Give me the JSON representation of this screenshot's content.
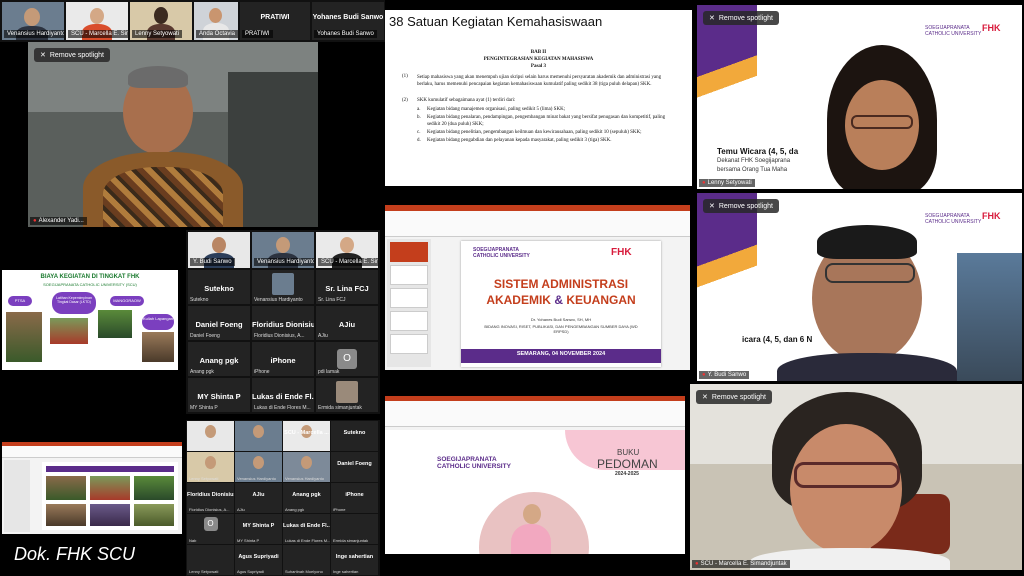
{
  "top_strip": {
    "cells": [
      {
        "name": "Venansius Hardiyanto"
      },
      {
        "name": "SCU - Marcella E. Sima..."
      },
      {
        "name": "Lenny Setyowati"
      },
      {
        "name": "Anda Octavia"
      },
      {
        "name": "PRATIWI",
        "label": "PRATIWI"
      },
      {
        "name": "Yohanes Budi Sanwo",
        "label": "Yohanes Budi Sanwo"
      }
    ]
  },
  "main_speaker": {
    "spotlight": "Remove spotlight",
    "name": "Alexander Yadi..."
  },
  "document": {
    "title": "38 Satuan Kegiatan Kemahasiswaan",
    "bab": "BAB II",
    "heading": "PENGINTEGRASIAN KEGIATAN MAHASISWA",
    "pasal": "Pasal 3",
    "para1_num": "(1)",
    "para1": "Setiap mahasiswa yang akan menempuh ujian skripsi selain harus memenuhi persyaratan akademik dan administrasi yang berlaku, harus memenuhi pencapaian kegiatan kemahasiswaan kumulatif paling sedikit 38 (tiga puluh delapan) SKK.",
    "para2_num": "(2)",
    "para2": "SKK kumulatif sebagaimana ayat (1) terdiri dari:",
    "items": [
      {
        "letter": "a.",
        "text": "Kegiatan bidang manajemen organisasi, paling sedikit 5 (lima) SKK;"
      },
      {
        "letter": "b.",
        "text": "Kegiatan bidang penalaran, pendampingan, pengembangan minat bakat yang bersifat penugasan dan kompetitif, paling sedikit 20 (dua puluh) SKK;"
      },
      {
        "letter": "c.",
        "text": "Kegiatan bidang penelitian, pengembangan keilmuan dan kewirausahaan, paling sedikit 10 (sepuluh) SKK;"
      },
      {
        "letter": "d.",
        "text": "Kegiatan bidang pengabdian dan pelayanan kepada masyarakat, paling sedikit 3 (tiga) SKK."
      }
    ]
  },
  "right_top": {
    "spotlight": "Remove spotlight",
    "name": "Lenny Setyowati",
    "brand": "SOEGIJAPRANATA CATHOLIC UNIVERSITY",
    "fhk": "FHK",
    "banner_title": "Temu Wicara (4, 5, da",
    "banner_sub1": "Dekanat FHK Soegijaprana",
    "banner_sub2": "bersama Orang Tua Maha"
  },
  "right_mid": {
    "spotlight": "Remove spotlight",
    "name": "Y. Budi Sanwo",
    "brand": "SOEGIJAPRANATA CATHOLIC UNIVERSITY",
    "fhk": "FHK",
    "banner_title": "icara (4, 5, dan 6 N"
  },
  "right_bottom": {
    "spotlight": "Remove spotlight",
    "name": "SCU - Marcella E. Simandjuntak"
  },
  "biaya_slide": {
    "title": "BIAYA KEGIATAN DI TINGKAT FHK",
    "subtitle": "SOEGIJAPRANATA CATHOLIC UNIVERSITY (SCU)",
    "labels": [
      "PTSA",
      "Latihan Kepemimpinan Tingkat Dasar (LKTD)",
      "MANGGRAOW",
      "Kuliah Lapangan"
    ]
  },
  "gallery_mid": {
    "top_names": [
      "Y. Budi Sanwo",
      "Venansius Hardiyanto",
      "SCU - Marcella E. Sima..."
    ],
    "cells": [
      {
        "name": "Sutekno",
        "sub": "Sutekno"
      },
      {
        "name": "",
        "sub": "Venansius Hardiyanto"
      },
      {
        "name": "Sr. Lina FCJ",
        "sub": "Sr. Lina FCJ"
      },
      {
        "name": "Daniel Foeng",
        "sub": "Daniel Foeng"
      },
      {
        "name": "Floridius Dionisius...",
        "sub": "Floridius Dionisius, A..."
      },
      {
        "name": "AJiu",
        "sub": "AJiu"
      },
      {
        "name": "Anang pgk",
        "sub": "Anang pgk"
      },
      {
        "name": "iPhone",
        "sub": "iPhone"
      },
      {
        "name": "O",
        "sub": "pdi lamak"
      },
      {
        "name": "MY Shinta P",
        "sub": "MY Shinta P"
      },
      {
        "name": "Lukas di Ende Fl...",
        "sub": "Lukas di Ende Flores M..."
      },
      {
        "name": "",
        "sub": "Ermida simanjuntak"
      }
    ]
  },
  "ppt_slide": {
    "brand": "SOEGIJAPRANATA CATHOLIC UNIVERSITY",
    "fhk": "FHK",
    "title1": "SISTEM ADMINISTRASI",
    "title2": "AKADEMIK",
    "amp": "&",
    "title3": "KEUANGAN",
    "presenter": "Dr. Yohanes Budi Sanwo, SH, MH",
    "role": "BIDANG INOVASI, RISET, PUBLIKASI, DAN PENGEMBANGAN SUMBER DAYA (WD ERPSD)",
    "date": "SEMARANG, 04 NOVEMBER 2024"
  },
  "gallery_bottom": {
    "cells": [
      {
        "name": "",
        "sub": ""
      },
      {
        "name": "",
        "sub": ""
      },
      {
        "name": "SCU - Marcella ...",
        "sub": ""
      },
      {
        "name": "Sutekno",
        "sub": ""
      },
      {
        "name": "",
        "sub": "Lenny Setyowati"
      },
      {
        "name": "",
        "sub": "Venansius Hardiyanto"
      },
      {
        "name": "",
        "sub": "Venansius Hardiyanto"
      },
      {
        "name": "Daniel Foeng",
        "sub": ""
      },
      {
        "name": "Floridius Dionisius...",
        "sub": "Floridius Dionisius, A..."
      },
      {
        "name": "AJiu",
        "sub": "AJiu"
      },
      {
        "name": "Anang pgk",
        "sub": "Anang pgk"
      },
      {
        "name": "iPhone",
        "sub": "iPhone"
      },
      {
        "name": "O",
        "sub": "Nab"
      },
      {
        "name": "MY Shinta P",
        "sub": "MY Shinta P"
      },
      {
        "name": "Lukas di Ende Fl...",
        "sub": "Lukas di Ende Flores M..."
      },
      {
        "name": "",
        "sub": "Ermida simanjuntak"
      },
      {
        "name": "",
        "sub": "Lenny Setyowati"
      },
      {
        "name": "Agus Supriyadi",
        "sub": "Agus Supriyadi"
      },
      {
        "name": "",
        "sub": "Suhartinah Moelyono"
      },
      {
        "name": "Inge sahertian",
        "sub": "Inge sahertian"
      }
    ]
  },
  "buku_slide": {
    "brand": "SOEGIJAPRANATA CATHOLIC UNIVERSITY",
    "book1": "BUKU",
    "book2": "PEDOMAN",
    "year": "2024-2025"
  },
  "watermark": "Dok. FHK SCU"
}
